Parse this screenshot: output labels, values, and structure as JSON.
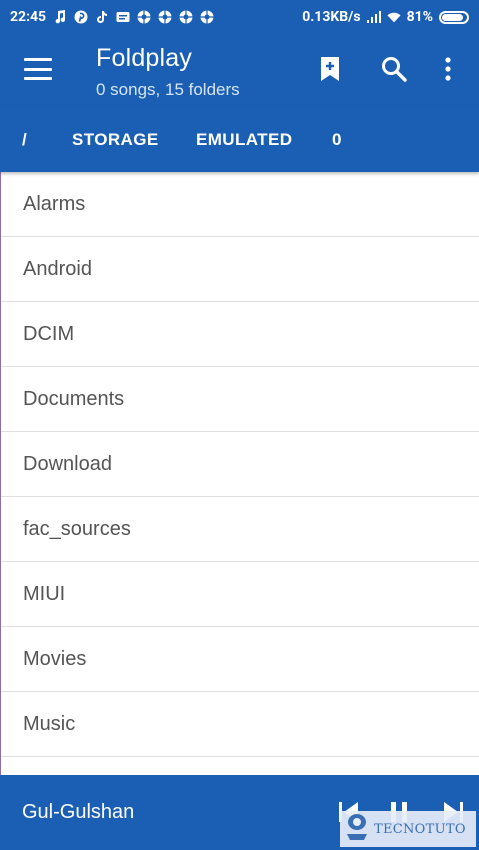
{
  "status_bar": {
    "time": "22:45",
    "network_speed": "0.13KB/s",
    "battery": "81%"
  },
  "app_bar": {
    "title": "Foldplay",
    "subtitle": "0 songs, 15 folders"
  },
  "breadcrumbs": [
    "/",
    "STORAGE",
    "EMULATED",
    "0"
  ],
  "folders": [
    "Alarms",
    "Android",
    "DCIM",
    "Documents",
    "Download",
    "fac_sources",
    "MIUI",
    "Movies",
    "Music"
  ],
  "player": {
    "song_title": "Gul-Gulshan"
  },
  "watermark": {
    "text": "TECNOTUTO"
  },
  "colors": {
    "primary": "#1b5fb4",
    "text": "#555555",
    "divider": "#e0e0e0"
  }
}
